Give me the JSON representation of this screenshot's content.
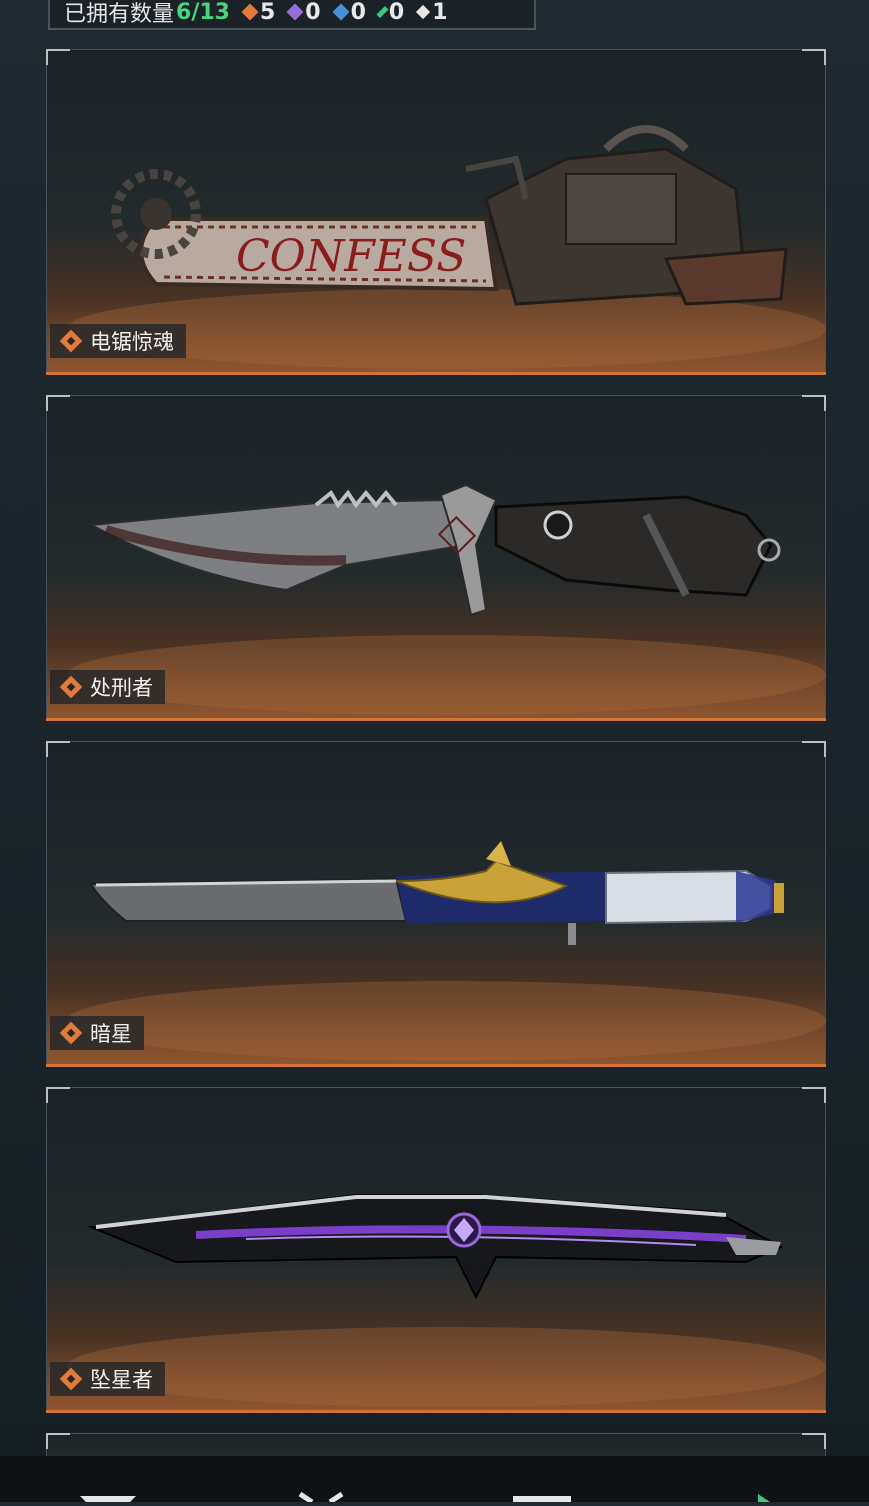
{
  "header": {
    "owned_label": "已拥有数量",
    "owned_count": "6/13",
    "stats": [
      {
        "icon": "orange-diamond-icon",
        "value": "5",
        "color": "#e07b3c"
      },
      {
        "icon": "purple-diamond-icon",
        "value": "0",
        "color": "#9b6cd8"
      },
      {
        "icon": "blue-diamond-icon",
        "value": "0",
        "color": "#4a8fd6"
      },
      {
        "icon": "green-diamond-icon",
        "value": "0",
        "color": "#3cc878"
      },
      {
        "icon": "white-diamond-icon",
        "value": "1",
        "color": "#e6e6e6"
      }
    ]
  },
  "items": [
    {
      "name": "电锯惊魂",
      "blade_text": "CONFESS"
    },
    {
      "name": "处刑者"
    },
    {
      "name": "暗星"
    },
    {
      "name": "坠星者"
    }
  ],
  "colors": {
    "accent": "#d27534",
    "owned_green": "#49d27a"
  }
}
